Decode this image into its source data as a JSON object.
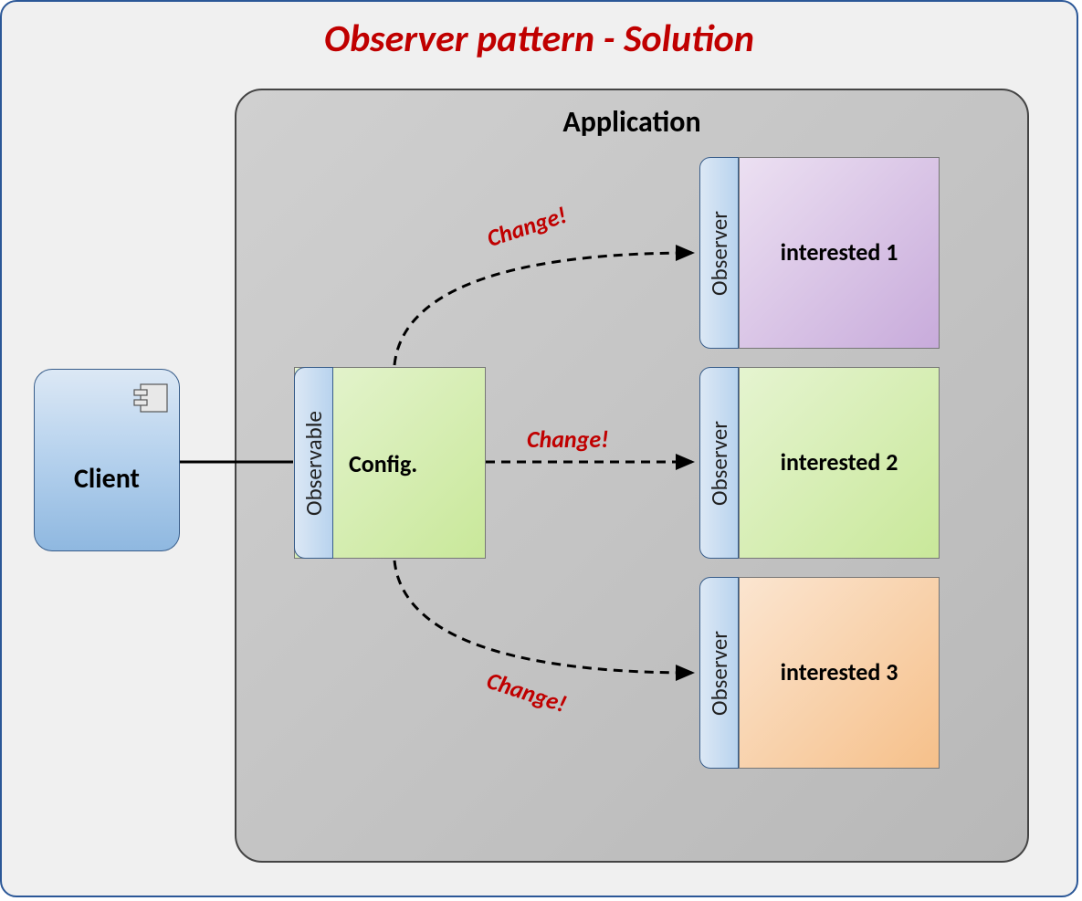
{
  "title": "Observer pattern  - Solution",
  "application_label": "Application",
  "client_label": "Client",
  "observable_tab": "Observable",
  "config_label": "Config.",
  "observer_tab": "Observer",
  "interested": {
    "one": "interested 1",
    "two": "interested 2",
    "three": "interested 3"
  },
  "change_label": "Change!"
}
